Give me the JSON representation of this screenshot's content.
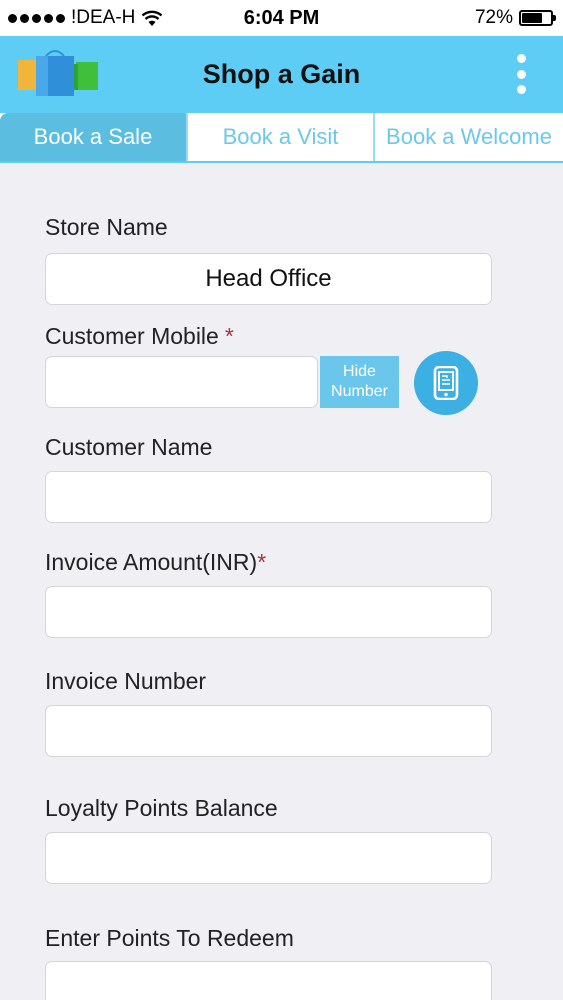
{
  "status_bar": {
    "carrier": "!DEA-H",
    "time": "6:04 PM",
    "battery_percent": "72%",
    "battery_level": 0.72
  },
  "header": {
    "title": "Shop a Gain",
    "logo": "shopping-bags-logo",
    "menu_icon": "vertical-dots-icon"
  },
  "tabs": [
    {
      "label": "Book a Sale",
      "active": true
    },
    {
      "label": "Book a Visit",
      "active": false
    },
    {
      "label": "Book a Welcome",
      "active": false
    }
  ],
  "form": {
    "store_name": {
      "label": "Store Name",
      "value": "Head Office"
    },
    "customer_mobile": {
      "label": "Customer Mobile",
      "required_mark": "*",
      "value": "",
      "hide_button_line1": "Hide",
      "hide_button_line2": "Number",
      "contact_icon": "mobile-phone-icon"
    },
    "customer_name": {
      "label": "Customer Name",
      "value": ""
    },
    "invoice_amount": {
      "label": "Invoice Amount(INR)",
      "required_mark": "*",
      "value": ""
    },
    "invoice_number": {
      "label": "Invoice Number",
      "value": ""
    },
    "loyalty_points_balance": {
      "label": "Loyalty Points Balance",
      "value": ""
    },
    "points_to_redeem": {
      "label": "Enter Points To Redeem",
      "value": ""
    }
  },
  "colors": {
    "header_bg": "#5ecdf5",
    "active_tab_bg": "#5bbde0",
    "tab_text": "#6cc8ea",
    "required": "#b03040",
    "contact_button": "#3cb0e2"
  }
}
